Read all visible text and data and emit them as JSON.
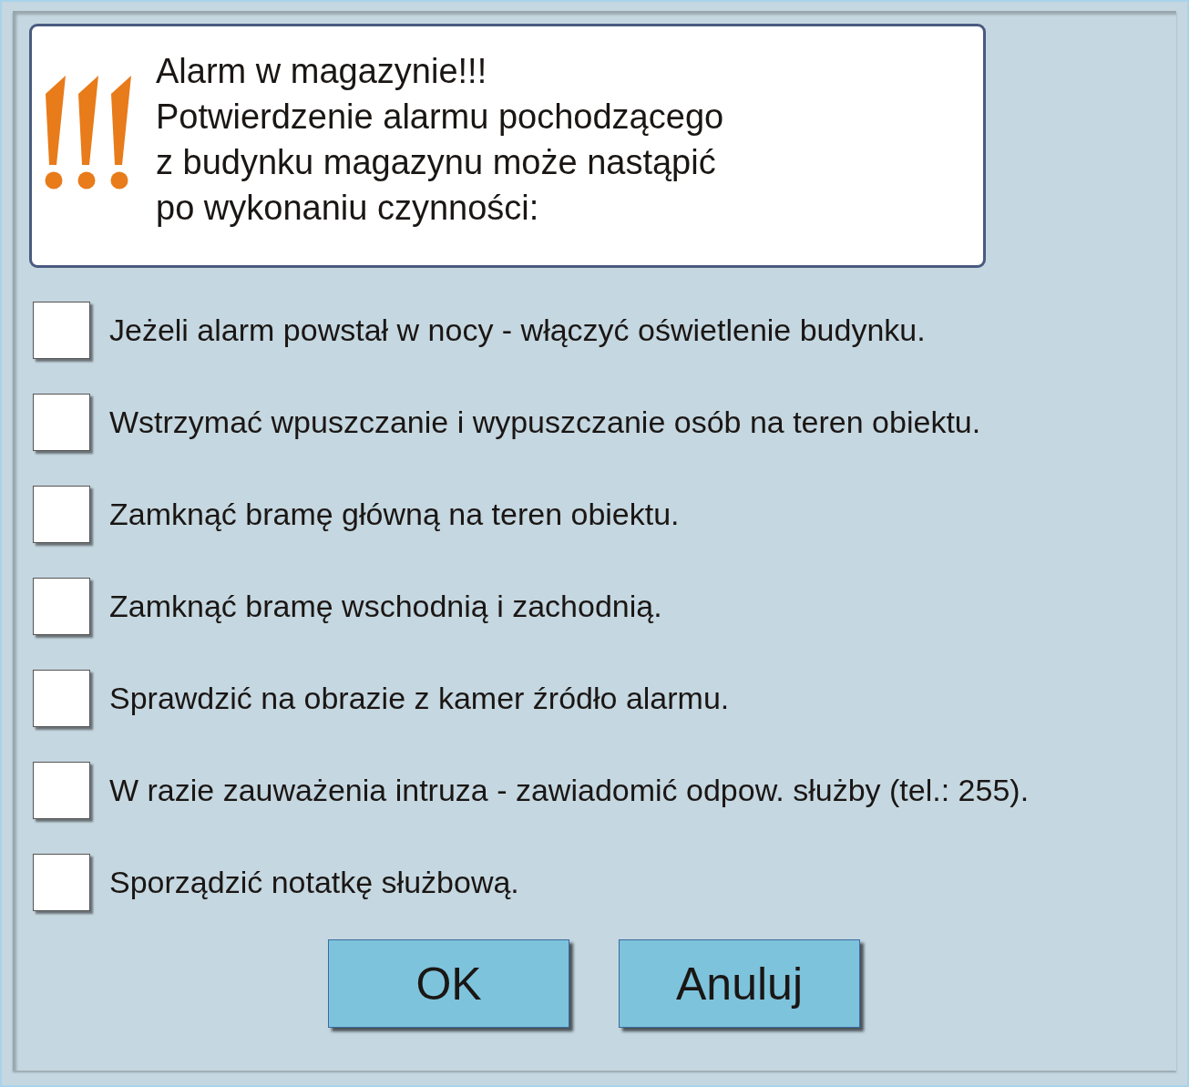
{
  "message": {
    "title": "Alarm w magazynie!!!",
    "lines": [
      "Potwierdzenie alarmu pochodzącego",
      "z budynku magazynu może nastąpić",
      "po wykonaniu czynności:"
    ]
  },
  "steps": [
    {
      "label": "Jeżeli alarm powstał w nocy - włączyć oświetlenie budynku.",
      "checked": false
    },
    {
      "label": "Wstrzymać wpuszczanie i wypuszczanie osób na teren obiektu.",
      "checked": false
    },
    {
      "label": "Zamknąć bramę główną na teren obiektu.",
      "checked": false
    },
    {
      "label": "Zamknąć bramę wschodnią i zachodnią.",
      "checked": false
    },
    {
      "label": "Sprawdzić na obrazie z kamer źródło alarmu.",
      "checked": false
    },
    {
      "label": "W razie zauważenia intruza - zawiadomić odpow. służby (tel.: 255).",
      "checked": false
    },
    {
      "label": "Sporządzić notatkę służbową.",
      "checked": false
    }
  ],
  "buttons": [
    "OK",
    "Anuluj"
  ]
}
